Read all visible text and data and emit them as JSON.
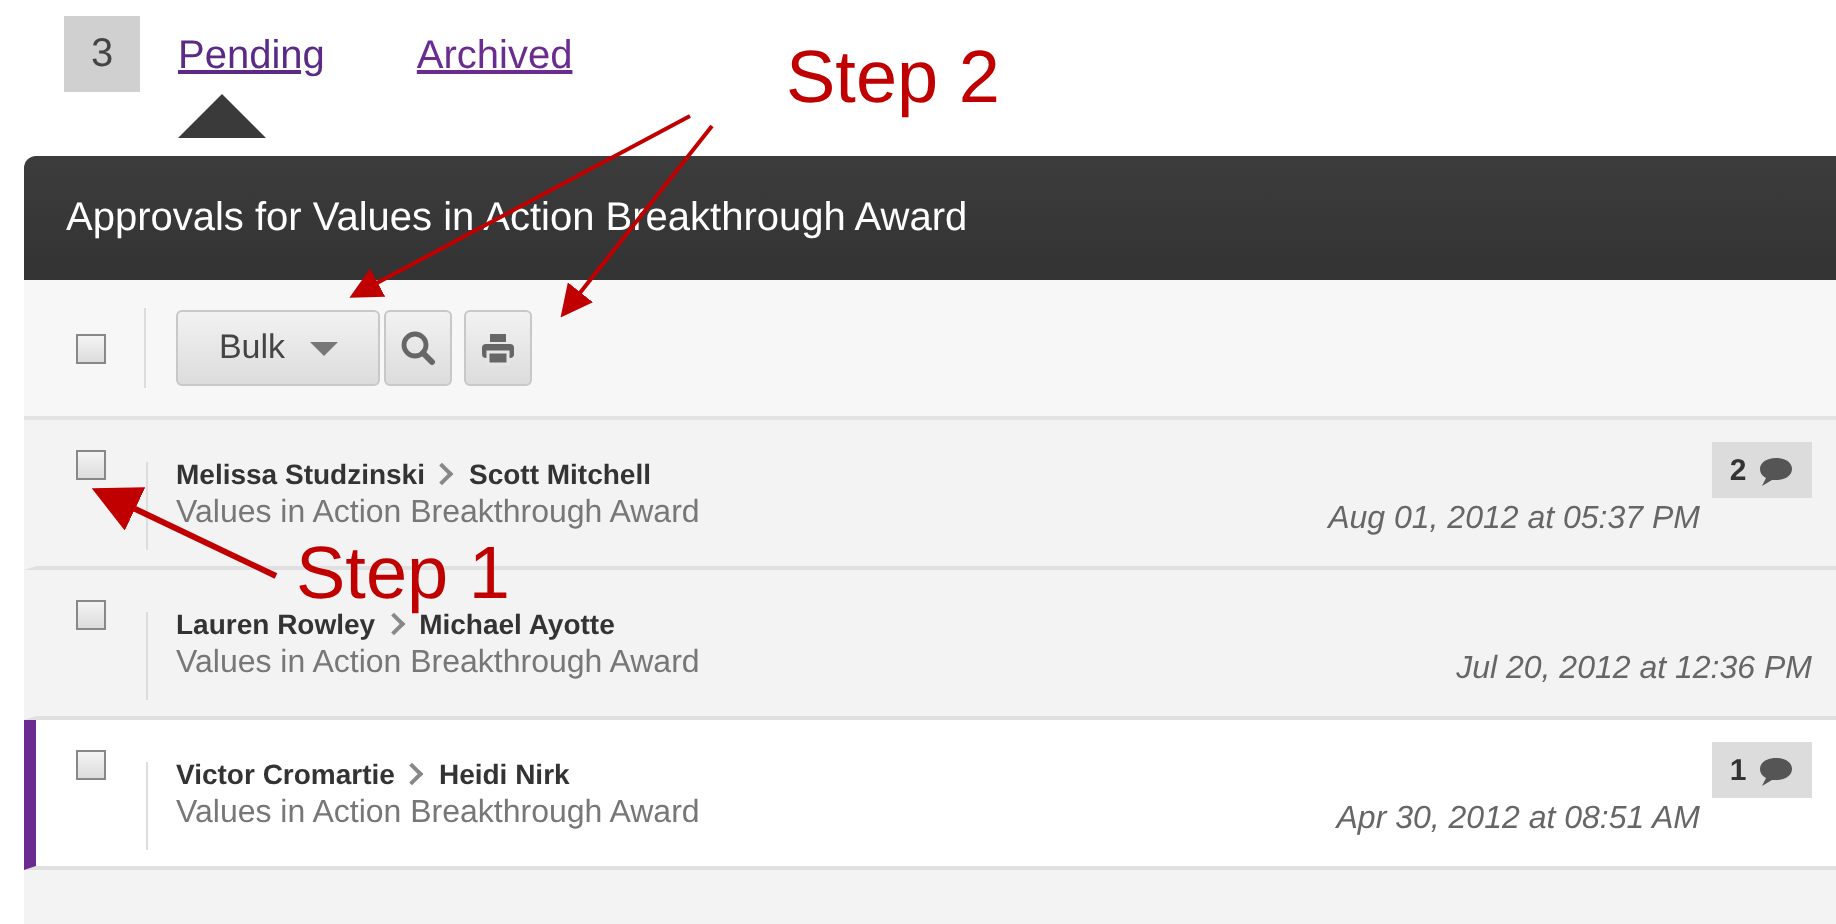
{
  "tabs": {
    "count": "3",
    "items": [
      {
        "label": "Pending",
        "selected": true
      },
      {
        "label": "Archived",
        "selected": false
      }
    ]
  },
  "panel": {
    "title": "Approvals for Values in Action Breakthrough Award"
  },
  "toolbar": {
    "select_all_checked": false,
    "bulk_label": "Bulk"
  },
  "rows": [
    {
      "checked": false,
      "highlighted": false,
      "from": "Melissa Studzinski",
      "to": "Scott Mitchell",
      "award": "Values in Action Breakthrough Award",
      "date": "Aug 01, 2012 at 05:37 PM",
      "comments": "2"
    },
    {
      "checked": false,
      "highlighted": false,
      "from": "Lauren Rowley",
      "to": "Michael Ayotte",
      "award": "Values in Action Breakthrough Award",
      "date": "Jul 20, 2012 at 12:36 PM"
    },
    {
      "checked": false,
      "highlighted": true,
      "from": "Victor Cromartie",
      "to": "Heidi Nirk",
      "award": "Values in Action Breakthrough Award",
      "date": "Apr 30, 2012 at 08:51 AM",
      "comments": "1"
    }
  ],
  "annotations": [
    {
      "text": "Step 2"
    },
    {
      "text": "Step 1"
    }
  ]
}
